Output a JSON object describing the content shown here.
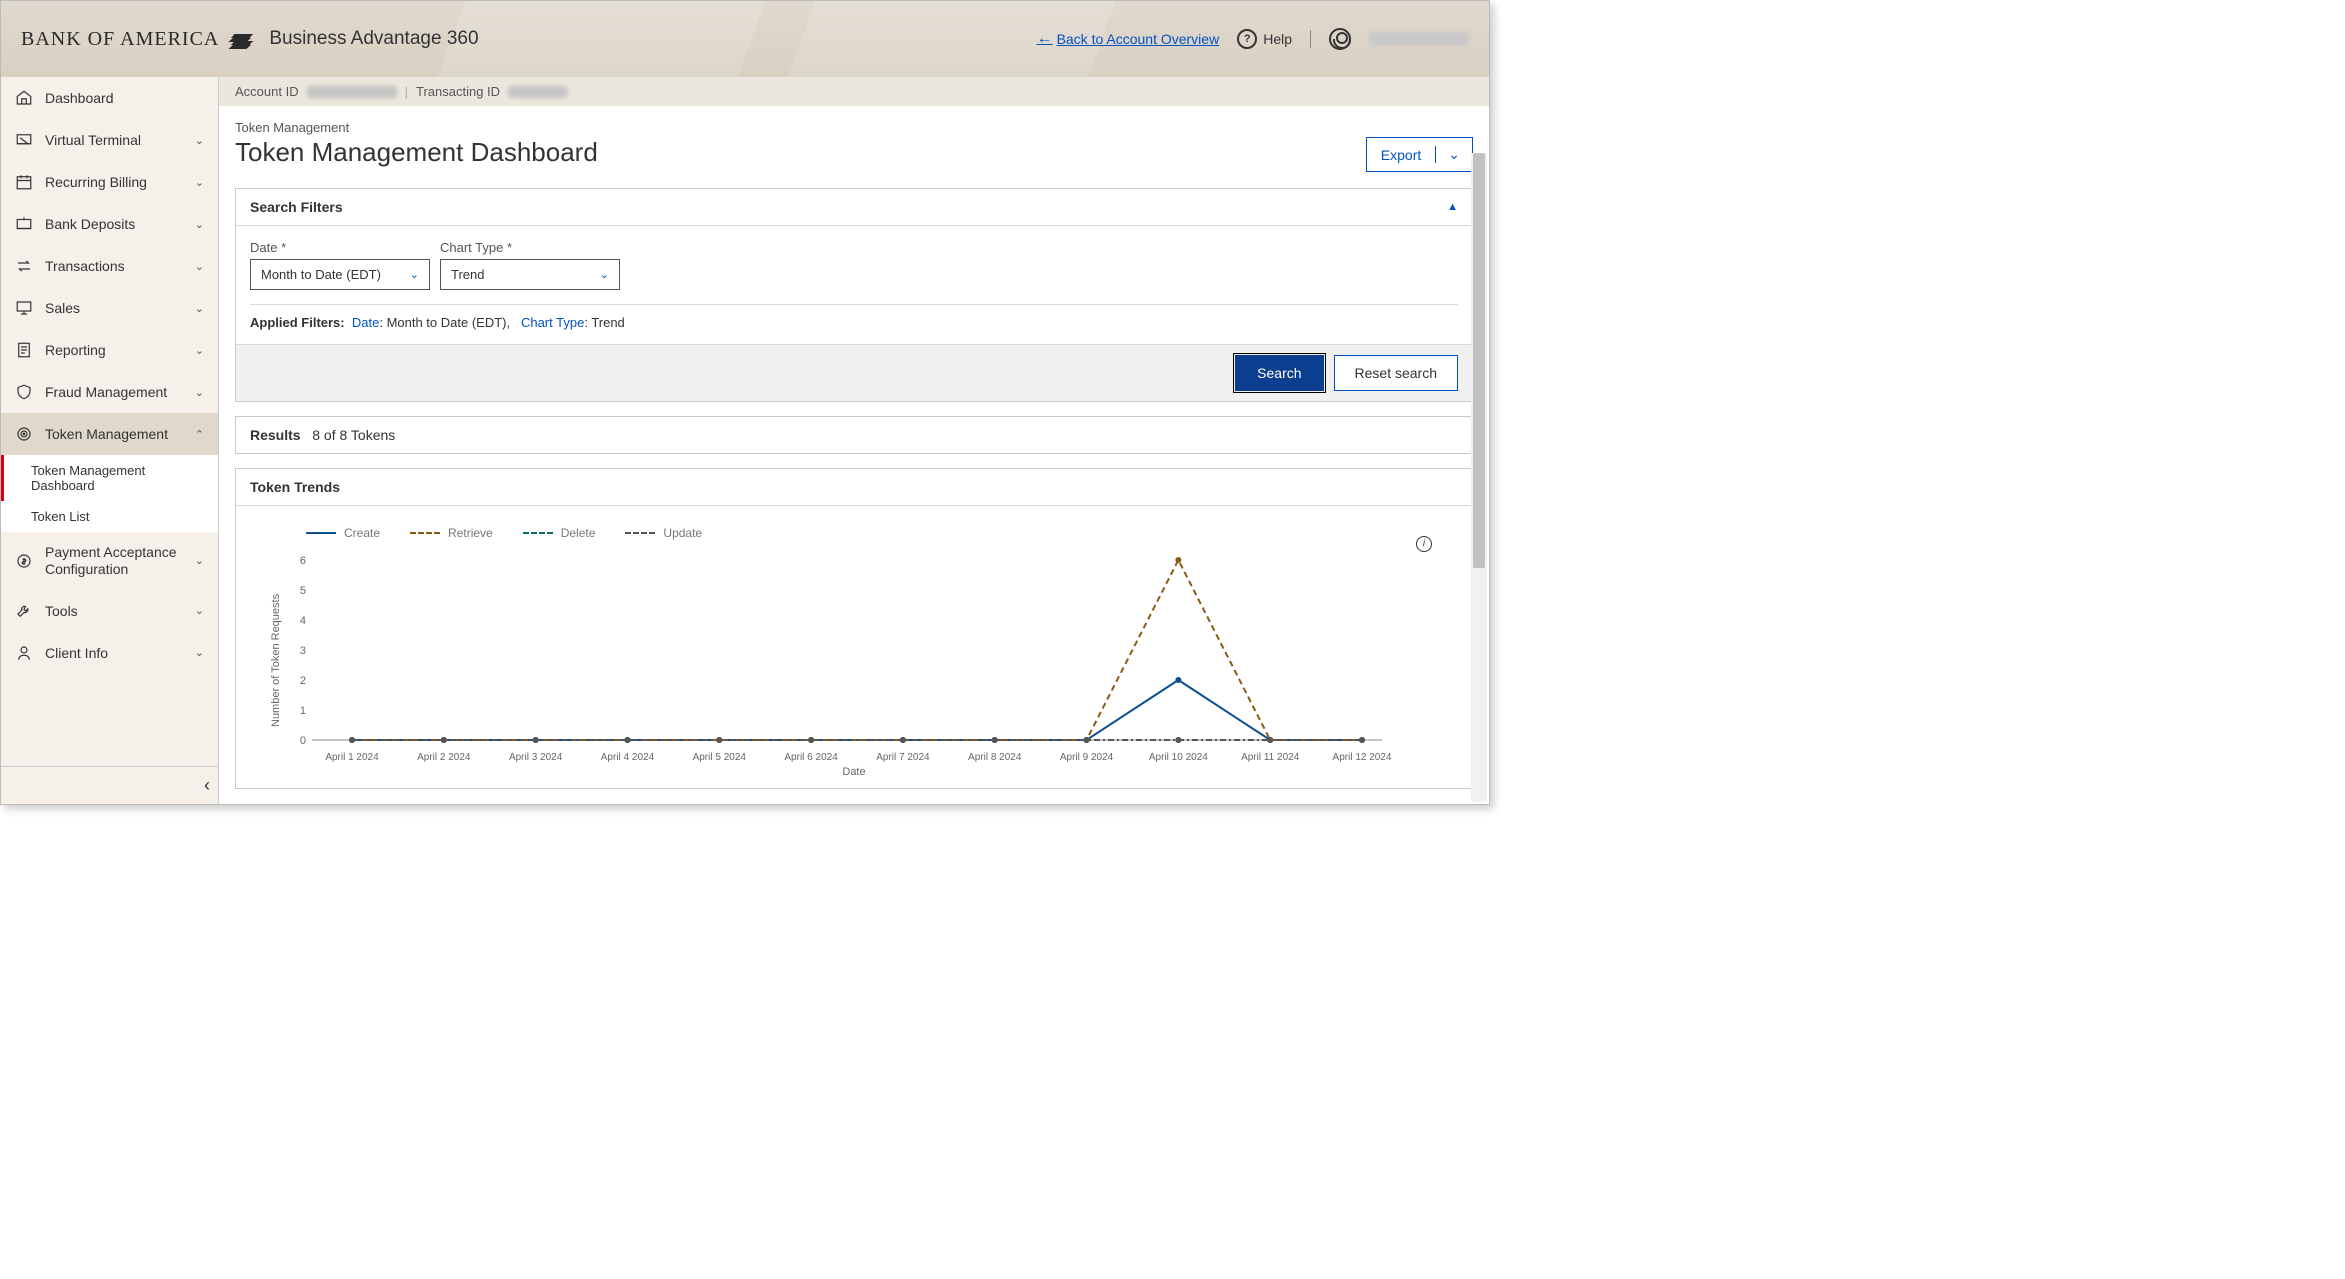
{
  "header": {
    "brand": "BANK OF AMERICA",
    "product": "Business Advantage 360",
    "back_link": "Back to Account Overview",
    "help": "Help"
  },
  "account_bar": {
    "account_id_label": "Account ID",
    "transacting_id_label": "Transacting ID"
  },
  "sidebar": {
    "items": [
      {
        "label": "Dashboard",
        "icon": "home",
        "expandable": false
      },
      {
        "label": "Virtual Terminal",
        "icon": "terminal",
        "expandable": true
      },
      {
        "label": "Recurring Billing",
        "icon": "calendar",
        "expandable": true
      },
      {
        "label": "Bank Deposits",
        "icon": "deposit",
        "expandable": true
      },
      {
        "label": "Transactions",
        "icon": "swap",
        "expandable": true
      },
      {
        "label": "Sales",
        "icon": "display",
        "expandable": true
      },
      {
        "label": "Reporting",
        "icon": "doc",
        "expandable": true
      },
      {
        "label": "Fraud Management",
        "icon": "shield",
        "expandable": true
      },
      {
        "label": "Token Management",
        "icon": "target",
        "expandable": true,
        "active": true,
        "children": [
          {
            "label": "Token Management Dashboard",
            "active": true
          },
          {
            "label": "Token List",
            "active": false
          }
        ]
      },
      {
        "label": "Payment Acceptance Configuration",
        "icon": "gear",
        "expandable": true
      },
      {
        "label": "Tools",
        "icon": "wrench",
        "expandable": true
      },
      {
        "label": "Client Info",
        "icon": "person",
        "expandable": true
      }
    ]
  },
  "page": {
    "subtitle": "Token Management",
    "title": "Token Management Dashboard",
    "export_label": "Export"
  },
  "filters": {
    "panel_title": "Search Filters",
    "date_label": "Date *",
    "date_value": "Month to Date (EDT)",
    "chart_type_label": "Chart Type *",
    "chart_type_value": "Trend",
    "applied_label": "Applied Filters:",
    "applied_date_key": "Date",
    "applied_date_val": "Month to Date (EDT)",
    "applied_ct_key": "Chart Type",
    "applied_ct_val": "Trend",
    "search_btn": "Search",
    "reset_btn": "Reset search"
  },
  "results": {
    "label": "Results",
    "summary": "8 of 8 Tokens"
  },
  "trends": {
    "title": "Token Trends",
    "legend": {
      "create": "Create",
      "retrieve": "Retrieve",
      "delete": "Delete",
      "update": "Update"
    }
  },
  "chart_data": {
    "type": "line",
    "title": "Token Trends",
    "xlabel": "Date",
    "ylabel": "Number of Token Requests",
    "ylim": [
      0,
      6
    ],
    "categories": [
      "April 1 2024",
      "April 2 2024",
      "April 3 2024",
      "April 4 2024",
      "April 5 2024",
      "April 6 2024",
      "April 7 2024",
      "April 8 2024",
      "April 9 2024",
      "April 10 2024",
      "April 11 2024",
      "April 12 2024"
    ],
    "series": [
      {
        "name": "Create",
        "style": "solid",
        "color": "#0b4f8f",
        "values": [
          0,
          0,
          0,
          0,
          0,
          0,
          0,
          0,
          0,
          2,
          0,
          0
        ]
      },
      {
        "name": "Retrieve",
        "style": "dashed",
        "color": "#8a5a16",
        "values": [
          0,
          0,
          0,
          0,
          0,
          0,
          0,
          0,
          0,
          6,
          0,
          0
        ]
      },
      {
        "name": "Delete",
        "style": "dashdot",
        "color": "#0f6e6e",
        "values": [
          0,
          0,
          0,
          0,
          0,
          0,
          0,
          0,
          0,
          0,
          0,
          0
        ]
      },
      {
        "name": "Update",
        "style": "dashdot",
        "color": "#555555",
        "values": [
          0,
          0,
          0,
          0,
          0,
          0,
          0,
          0,
          0,
          0,
          0,
          0
        ]
      }
    ]
  }
}
